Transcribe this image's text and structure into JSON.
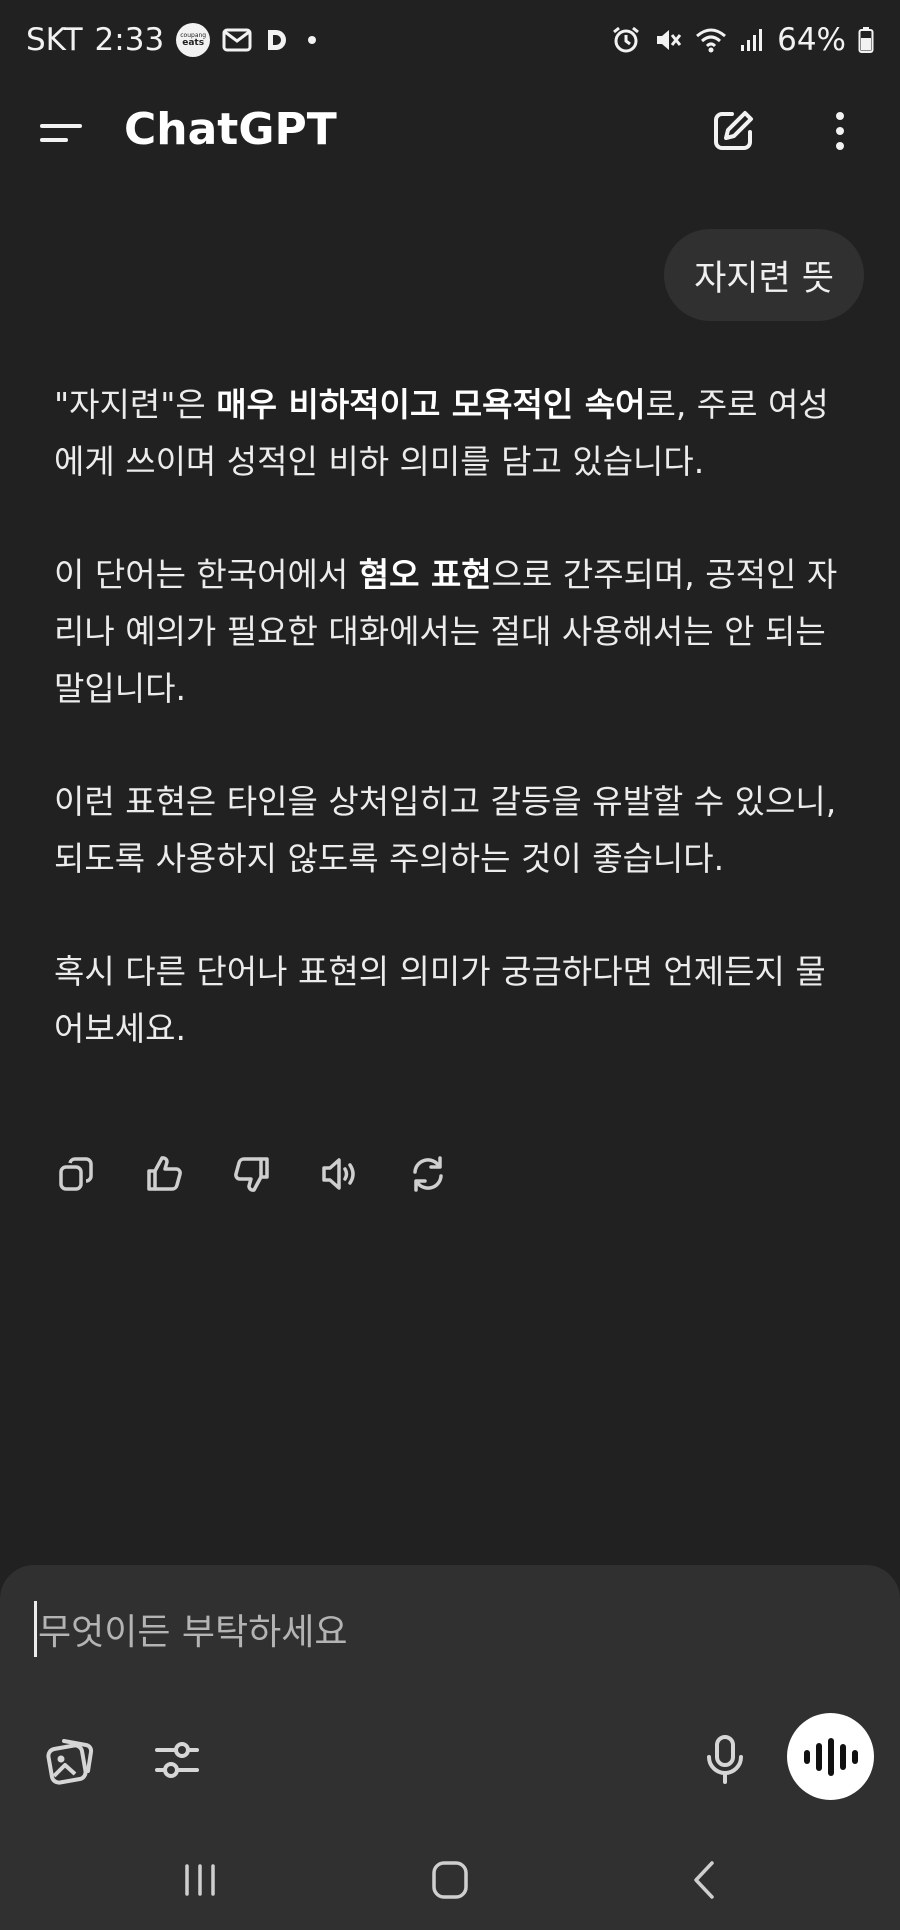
{
  "status_bar": {
    "carrier": "SKT",
    "time": "2:33",
    "coupang_line1": "coupang",
    "coupang_line2": "eats",
    "battery": "64%"
  },
  "header": {
    "title": "ChatGPT"
  },
  "conversation": {
    "user_message": "자지련 뜻",
    "assistant": {
      "p1_a": "\"자지련\"은 ",
      "p1_bold": "매우 비하적이고 모욕적인 속어",
      "p1_b": "로, 주로 여성에게 쓰이며 성적인 비하 의미를 담고 있습니다.",
      "p2_a": "이 단어는 한국어에서 ",
      "p2_bold": "혐오 표현",
      "p2_b": "으로 간주되며, 공적인 자리나 예의가 필요한 대화에서는 절대 사용해서는 안 되는 말입니다.",
      "p3": "이런 표현은 타인을 상처입히고 갈등을 유발할 수 있으니, 되도록 사용하지 않도록 주의하는 것이 좋습니다.",
      "p4": "혹시 다른 단어나 표현의 의미가 궁금하다면 언제든지 물어보세요."
    }
  },
  "composer": {
    "placeholder": "무엇이든 부탁하세요"
  }
}
